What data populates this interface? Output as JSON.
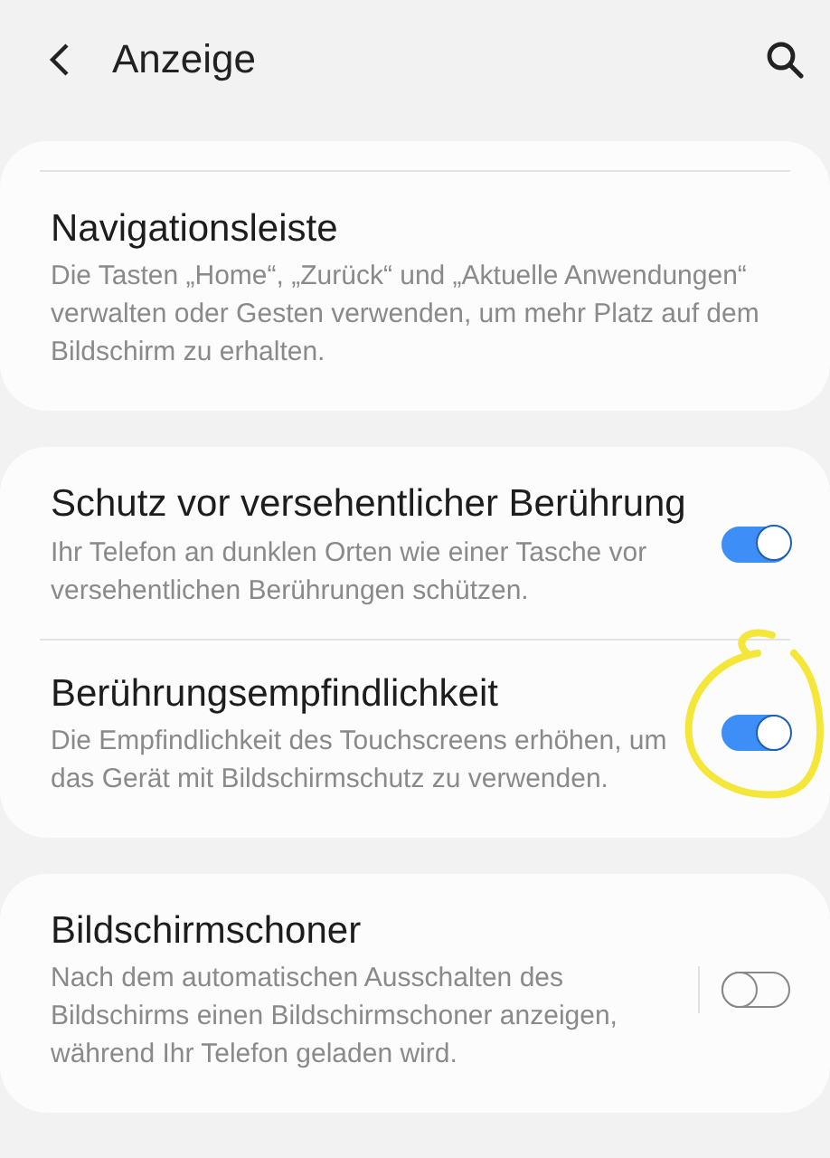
{
  "header": {
    "title": "Anzeige"
  },
  "cards": [
    {
      "items": [
        {
          "kind": "text",
          "title": "Navigationsleiste",
          "description": "Die Tasten „Home“, „Zurück“ und „Aktuelle Anwendungen“ verwalten oder Gesten verwenden, um mehr Platz auf dem Bildschirm zu erhalten."
        }
      ]
    },
    {
      "items": [
        {
          "kind": "switch",
          "title": "Schutz vor versehentlicher Berührung",
          "description": "Ihr Telefon an dunklen Orten wie einer Tasche vor versehentlichen Berührungen schützen.",
          "on": true
        },
        {
          "kind": "switch",
          "title": "Berührungsempfindlichkeit",
          "description": "Die Empfindlichkeit des Touchscreens erhöhen, um das Gerät mit Bildschirmschutz zu verwenden.",
          "on": true,
          "circled": true
        }
      ]
    },
    {
      "items": [
        {
          "kind": "switch",
          "title": "Bildschirmschoner",
          "description": "Nach dem automatischen Ausschalten des Bildschirms einen Bildschirmschoner anzeigen, während Ihr Telefon geladen wird.",
          "on": false,
          "divider": true
        }
      ]
    }
  ]
}
